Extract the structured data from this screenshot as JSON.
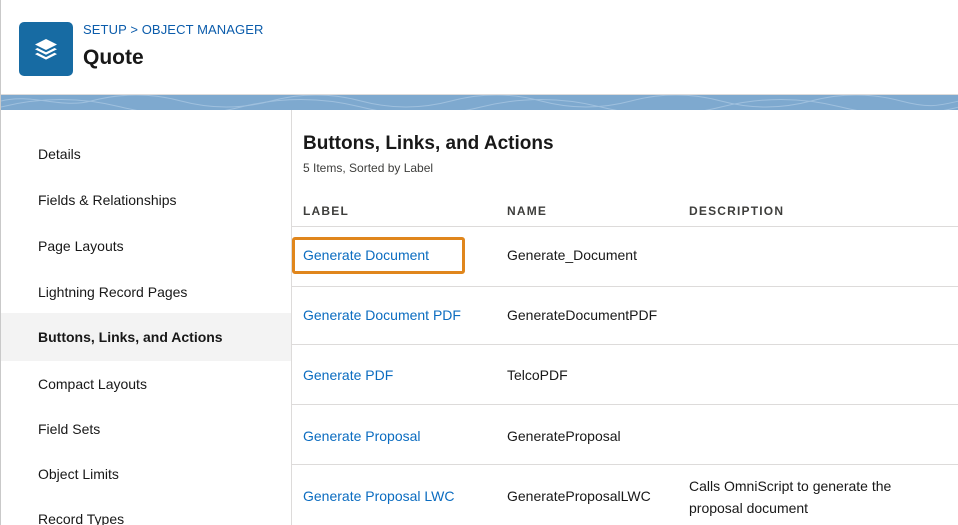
{
  "header": {
    "breadcrumb": "SETUP > OBJECT MANAGER",
    "title": "Quote",
    "icon": "layers-icon"
  },
  "sidebar": {
    "items": [
      {
        "label": "Details",
        "active": false
      },
      {
        "label": "Fields & Relationships",
        "active": false
      },
      {
        "label": "Page Layouts",
        "active": false
      },
      {
        "label": "Lightning Record Pages",
        "active": false
      },
      {
        "label": "Buttons, Links, and Actions",
        "active": true
      },
      {
        "label": "Compact Layouts",
        "active": false
      },
      {
        "label": "Field Sets",
        "active": false
      },
      {
        "label": "Object Limits",
        "active": false
      },
      {
        "label": "Record Types",
        "active": false
      }
    ]
  },
  "main": {
    "title": "Buttons, Links, and Actions",
    "subtitle": "5 Items, Sorted by Label",
    "columns": [
      "LABEL",
      "NAME",
      "DESCRIPTION"
    ],
    "rows": [
      {
        "label": "Generate Document",
        "name": "Generate_Document",
        "description": [
          "",
          ""
        ],
        "highlighted": true
      },
      {
        "label": "Generate Document PDF",
        "name": "GenerateDocumentPDF",
        "description": [
          "",
          ""
        ],
        "highlighted": false
      },
      {
        "label": "Generate PDF",
        "name": "TelcoPDF",
        "description": [
          "",
          ""
        ],
        "highlighted": false
      },
      {
        "label": "Generate Proposal",
        "name": "GenerateProposal",
        "description": [
          "",
          ""
        ],
        "highlighted": false
      },
      {
        "label": "Generate Proposal LWC",
        "name": "GenerateProposalLWC",
        "description": [
          "Calls OmniScript to generate the",
          "proposal document"
        ],
        "highlighted": false
      }
    ]
  },
  "colors": {
    "brand_icon": "#176ba3",
    "link": "#0b6cc0",
    "highlight": "#e0861c",
    "band": "#7ea9cf"
  }
}
